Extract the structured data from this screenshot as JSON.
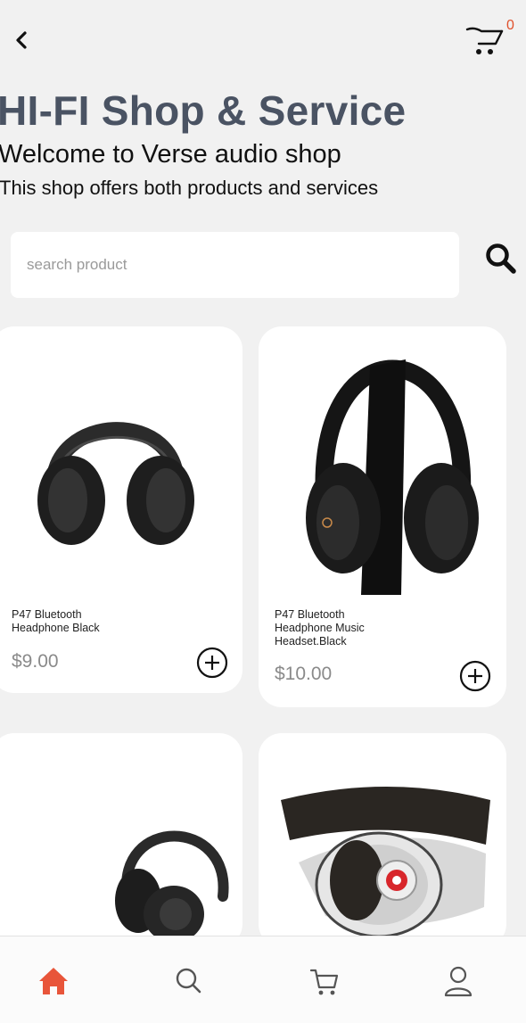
{
  "header": {
    "back_icon": "chevron-left-icon",
    "cart_icon": "cart-icon",
    "cart_count": "0"
  },
  "hero": {
    "title": "HI-FI Shop & Service",
    "welcome": "Welcome to Verse audio shop",
    "subtitle": "This shop offers both products and services"
  },
  "search": {
    "placeholder": "search product",
    "value": "",
    "icon": "search-icon"
  },
  "products": [
    {
      "name": "P47 Bluetooth\nHeadphone Black",
      "price": "$9.00",
      "image": "headphone-image",
      "add_icon": "plus-circle-icon"
    },
    {
      "name": "P47 Bluetooth\nHeadphone Music\nHeadset.Black",
      "price": "$10.00",
      "image": "headphone-image",
      "add_icon": "plus-circle-icon"
    },
    {
      "image": "headphone-image"
    },
    {
      "image": "headphone-image"
    }
  ],
  "bottom_nav": {
    "items": [
      {
        "icon": "home-icon",
        "active": true
      },
      {
        "icon": "search-icon",
        "active": false
      },
      {
        "icon": "cart-icon",
        "active": false
      },
      {
        "icon": "user-icon",
        "active": false
      }
    ],
    "active_color": "#e8553a",
    "inactive_color": "#555555"
  },
  "colors": {
    "title": "#4a5363",
    "background": "#f1f1f1",
    "card": "#ffffff",
    "accent": "#e8553a"
  }
}
